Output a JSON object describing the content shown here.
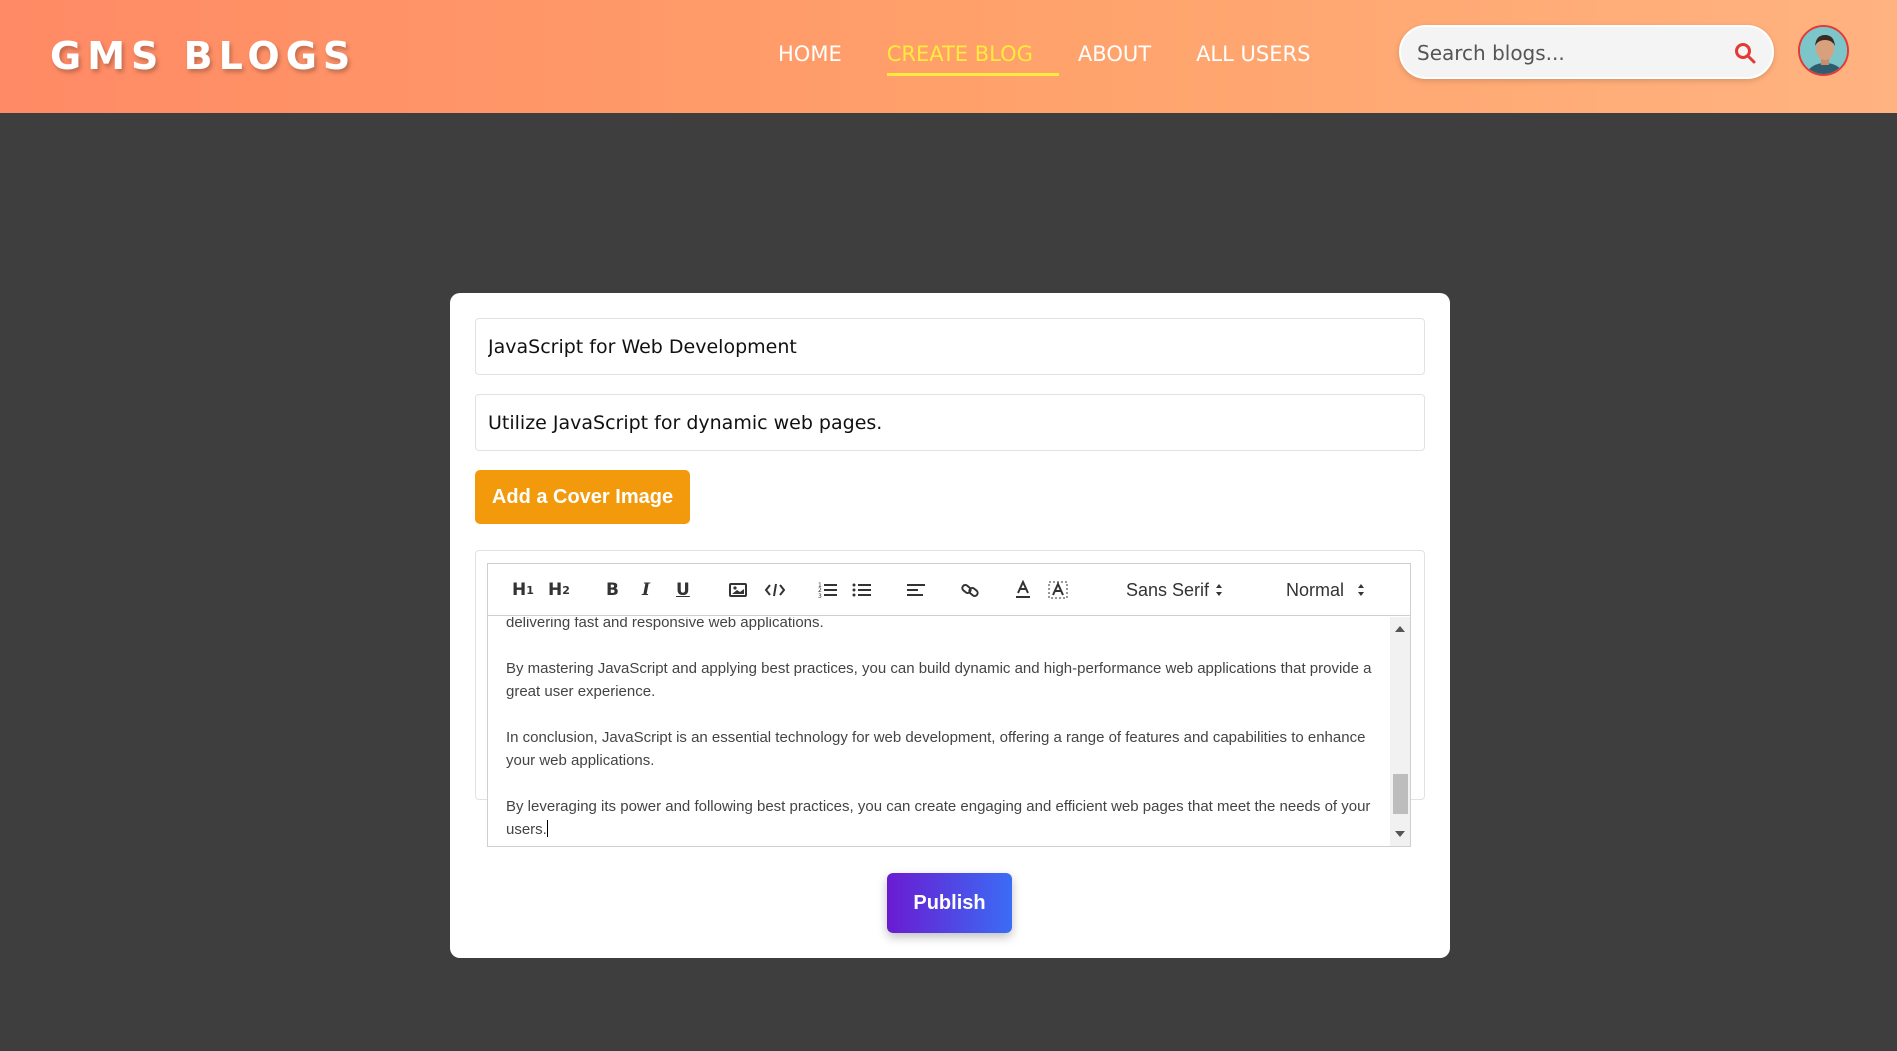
{
  "app": {
    "logo": "GMS BLOGS"
  },
  "nav": {
    "items": [
      {
        "label": "HOME",
        "active": false
      },
      {
        "label": "CREATE BLOG",
        "active": true
      },
      {
        "label": "ABOUT",
        "active": false
      },
      {
        "label": "ALL USERS",
        "active": false
      }
    ]
  },
  "search": {
    "placeholder": "Search blogs...",
    "value": ""
  },
  "form": {
    "title_value": "JavaScript for Web Development",
    "description_value": "Utilize JavaScript for dynamic web pages.",
    "cover_button": "Add a Cover Image",
    "publish_button": "Publish"
  },
  "editor": {
    "toolbar": {
      "h1": "H1",
      "h2": "H2",
      "bold": "B",
      "italic": "I",
      "underline": "U",
      "font_select": "Sans Serif",
      "size_select": "Normal"
    },
    "paragraphs": [
      "delivering fast and responsive web applications.",
      "By mastering JavaScript and applying best practices, you can build dynamic and high-performance web applications that provide a great user experience.",
      "In conclusion, JavaScript is an essential technology for web development, offering a range of features and capabilities to enhance your web applications.",
      "By leveraging its power and following best practices, you can create engaging and efficient web pages that meet the needs of your users."
    ]
  },
  "colors": {
    "accent_active": "#ffeb3b",
    "cover_button": "#f29a0b",
    "publish_gradient_start": "#6a1bd1",
    "publish_gradient_end": "#3b6cf6",
    "search_icon": "#e53935"
  }
}
